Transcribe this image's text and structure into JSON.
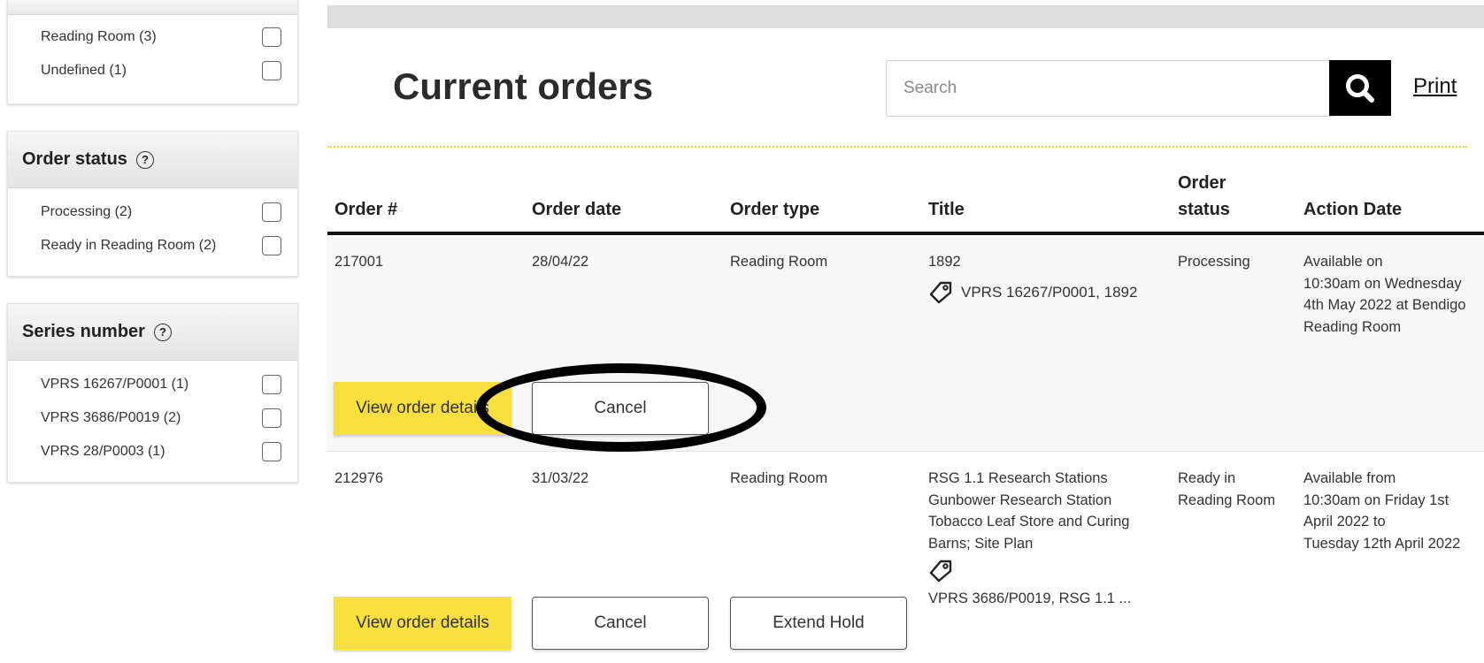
{
  "sidebar": {
    "location_items": [
      {
        "label": "Reading Room (3)"
      },
      {
        "label": "Undefined (1)"
      }
    ],
    "order_status": {
      "title": "Order status",
      "help": "?",
      "items": [
        {
          "label": "Processing (2)"
        },
        {
          "label": "Ready in Reading Room (2)"
        }
      ]
    },
    "series_number": {
      "title": "Series number",
      "help": "?",
      "items": [
        {
          "label": "VPRS 16267/P0001 (1)"
        },
        {
          "label": "VPRS 3686/P0019 (2)"
        },
        {
          "label": "VPRS 28/P0003 (1)"
        }
      ]
    }
  },
  "header": {
    "title": "Current orders",
    "search_placeholder": "Search",
    "print_label": "Print"
  },
  "table": {
    "columns": {
      "order_no": "Order #",
      "order_date": "Order date",
      "order_type": "Order type",
      "title": "Title",
      "order_status_1": "Order",
      "order_status_2": "status",
      "action_date": "Action Date"
    },
    "rows": [
      {
        "order_no": "217001",
        "order_date": "28/04/22",
        "order_type": "Reading Room",
        "title": "1892",
        "tag": "VPRS 16267/P0001, 1892",
        "status": "Processing",
        "action_lines": [
          "Available on",
          "10:30am on Wednesday",
          "4th May 2022 at Bendigo",
          "Reading Room"
        ],
        "view_label": "View order details",
        "cancel_label": "Cancel"
      },
      {
        "order_no": "212976",
        "order_date": "31/03/22",
        "order_type": "Reading Room",
        "title_lines": [
          "RSG 1.1 Research Stations",
          "Gunbower Research Station",
          "Tobacco Leaf Store and Curing",
          "Barns; Site Plan"
        ],
        "tag": "VPRS 3686/P0019, RSG 1.1 ...",
        "status_lines": [
          "Ready in",
          "Reading Room"
        ],
        "action_lines": [
          "Available from",
          "10:30am on Friday 1st",
          "April 2022 to",
          "Tuesday 12th April 2022"
        ],
        "view_label": "View order details",
        "cancel_label": "Cancel",
        "extend_label": "Extend Hold"
      }
    ]
  }
}
